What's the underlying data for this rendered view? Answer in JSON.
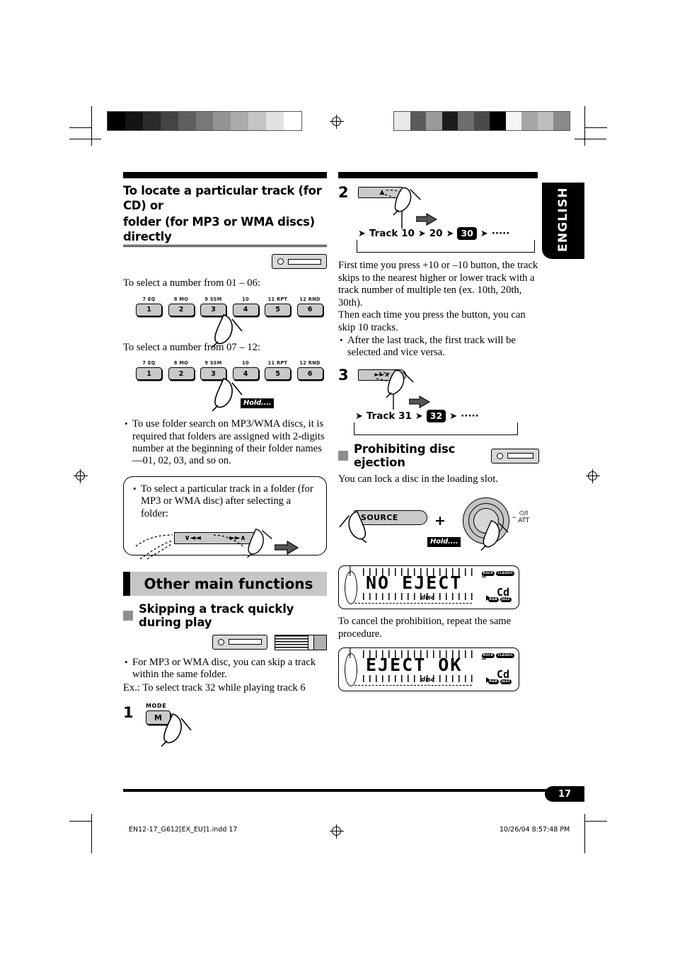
{
  "page": {
    "language_tab": "ENGLISH",
    "page_number": "17"
  },
  "left_column": {
    "heading_line1": "To locate a particular track (for CD) or",
    "heading_line2": "folder (for MP3 or WMA discs) directly",
    "media_icon_cd": "cd-source-icon",
    "instruction_01_06": "To select a number from 01 – 06:",
    "instruction_07_12": "To select a number from 07 – 12:",
    "keypad": [
      {
        "top": "7 EQ",
        "num": "1"
      },
      {
        "top": "8 MO",
        "num": "2"
      },
      {
        "top": "9 SSM",
        "num": "3"
      },
      {
        "top": "10",
        "num": "4"
      },
      {
        "top": "11 RPT",
        "num": "5"
      },
      {
        "top": "12 RND",
        "num": "6"
      }
    ],
    "hold_label": "Hold....",
    "folder_search_note": "To use folder search on MP3/WMA discs, it is required that folders are assigned with 2-digits number at the beginning of their folder names—01, 02, 03, and so on.",
    "note_box": {
      "text": "To select a particular track in a folder (for MP3 or WMA disc) after selecting a folder:",
      "rocker_left": "∨◄◄",
      "rocker_right": "►►∧"
    },
    "section_banner": "Other main functions",
    "subsection_title": "Skipping a track quickly during play",
    "media_icons": [
      "cd-source-icon",
      "cd-changer-icon"
    ],
    "bullet_mp3": "For MP3 or WMA disc, you can skip a track within the same folder.",
    "example_line": "Ex.: To select track 32 while playing track 6",
    "step1": {
      "number": "1",
      "button_label": "MODE",
      "button_face": "M"
    }
  },
  "right_column": {
    "step2": {
      "number": "2",
      "control_symbol": "▲",
      "flow": [
        "Track 10",
        "20",
        "30",
        "·····"
      ],
      "flow_highlight_index": 2,
      "paragraph1": "First time you press +10 or –10 button, the track skips to the nearest higher or lower track with a track number of multiple ten (ex. 10th, 20th, 30th).",
      "paragraph2": "Then each time you press the button, you can skip 10 tracks.",
      "bullet": "After the last track, the first track will be selected and vice versa."
    },
    "step3": {
      "number": "3",
      "control_symbol": "►►∧",
      "flow": [
        "Track 31",
        "32",
        "·····"
      ],
      "flow_highlight_index": 1
    },
    "prohibit": {
      "title": "Prohibiting disc ejection",
      "media_icon": "cd-source-icon",
      "intro": "You can lock a disc in the loading slot.",
      "source_button": "SOURCE",
      "plus": "+",
      "hold_label": "Hold....",
      "knob_label_line1": "⏻/I",
      "knob_label_line2": "ATT",
      "knob_minus": "–",
      "display_no_eject": "NO EJECT",
      "cancel_text": "To cancel the prohibition, repeat the same procedure.",
      "display_eject_ok": "EJECT OK"
    },
    "lcd": {
      "disc_label": "disc",
      "cd_label": "Cd",
      "left_arc_label": "soundscape",
      "tags_top": [
        "ROCK",
        "CLASSIC",
        "POPS"
      ],
      "tags_bottom": [
        "R&B",
        "JAZZ"
      ],
      "lock_icon": "lock-icon"
    }
  },
  "footer": {
    "file_name": "EN12-17_G612[EX_EU]1.indd   17",
    "timestamp": "10/26/04   8:57:48 PM"
  },
  "print_marks": {
    "gray_bar_left": [
      "#000000",
      "#141414",
      "#2b2b2b",
      "#444444",
      "#5e5e5e",
      "#787878",
      "#949494",
      "#ababab",
      "#c4c4c4",
      "#e2e2e2",
      "#ffffff"
    ],
    "gray_bar_right": [
      "#e8e8e8",
      "#5a5a5a",
      "#9a9a9a",
      "#1c1c1c",
      "#6e6e6e",
      "#4a4a4a",
      "#000000",
      "#f4f4f4",
      "#a6a6a6",
      "#bdbdbd",
      "#8a8a8a"
    ]
  }
}
